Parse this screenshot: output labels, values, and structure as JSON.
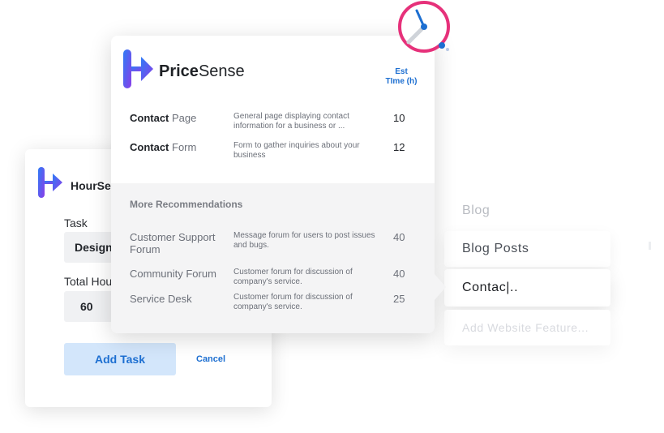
{
  "background_list": {
    "items": [
      "Blog",
      "Blog Posts",
      "Contac|..",
      "Add Website Feature..."
    ]
  },
  "hour_card": {
    "brand": "HourSense",
    "task_label": "Task",
    "task_value": "Design",
    "hours_label": "Total Hours",
    "hours_value": "60",
    "add_button": "Add Task",
    "cancel_button": "Cancel"
  },
  "price_card": {
    "brand_bold": "Price",
    "brand_light": "Sense",
    "est_header_line1": "Est",
    "est_header_line2": "TIme (h)",
    "rows": [
      {
        "name_bold": "Contact",
        "name_light": "Page",
        "desc": "General page displaying contact information for a business or ...",
        "hours": "10"
      },
      {
        "name_bold": "Contact",
        "name_light": "Form",
        "desc": "Form to gather inquiries about your business",
        "hours": "12"
      }
    ],
    "more_title": "More Recommendations",
    "more": [
      {
        "name": "Customer Support Forum",
        "desc": "Message forum for users to post issues and bugs.",
        "hours": "40"
      },
      {
        "name": "Community Forum",
        "desc": "Customer forum for discussion of company's service.",
        "hours": "40"
      },
      {
        "name": "Service Desk",
        "desc": "Customer forum for discussion of company's service.",
        "hours": "25"
      }
    ]
  },
  "colors": {
    "accent_blue": "#1d6fd1",
    "clock_ring": "#e6317a",
    "logo_gradient_start": "#2f7cf6",
    "logo_gradient_end": "#8a3ee8"
  },
  "icons": [
    "hoursense-logo-icon",
    "pricesense-logo-icon",
    "clock-icon"
  ]
}
